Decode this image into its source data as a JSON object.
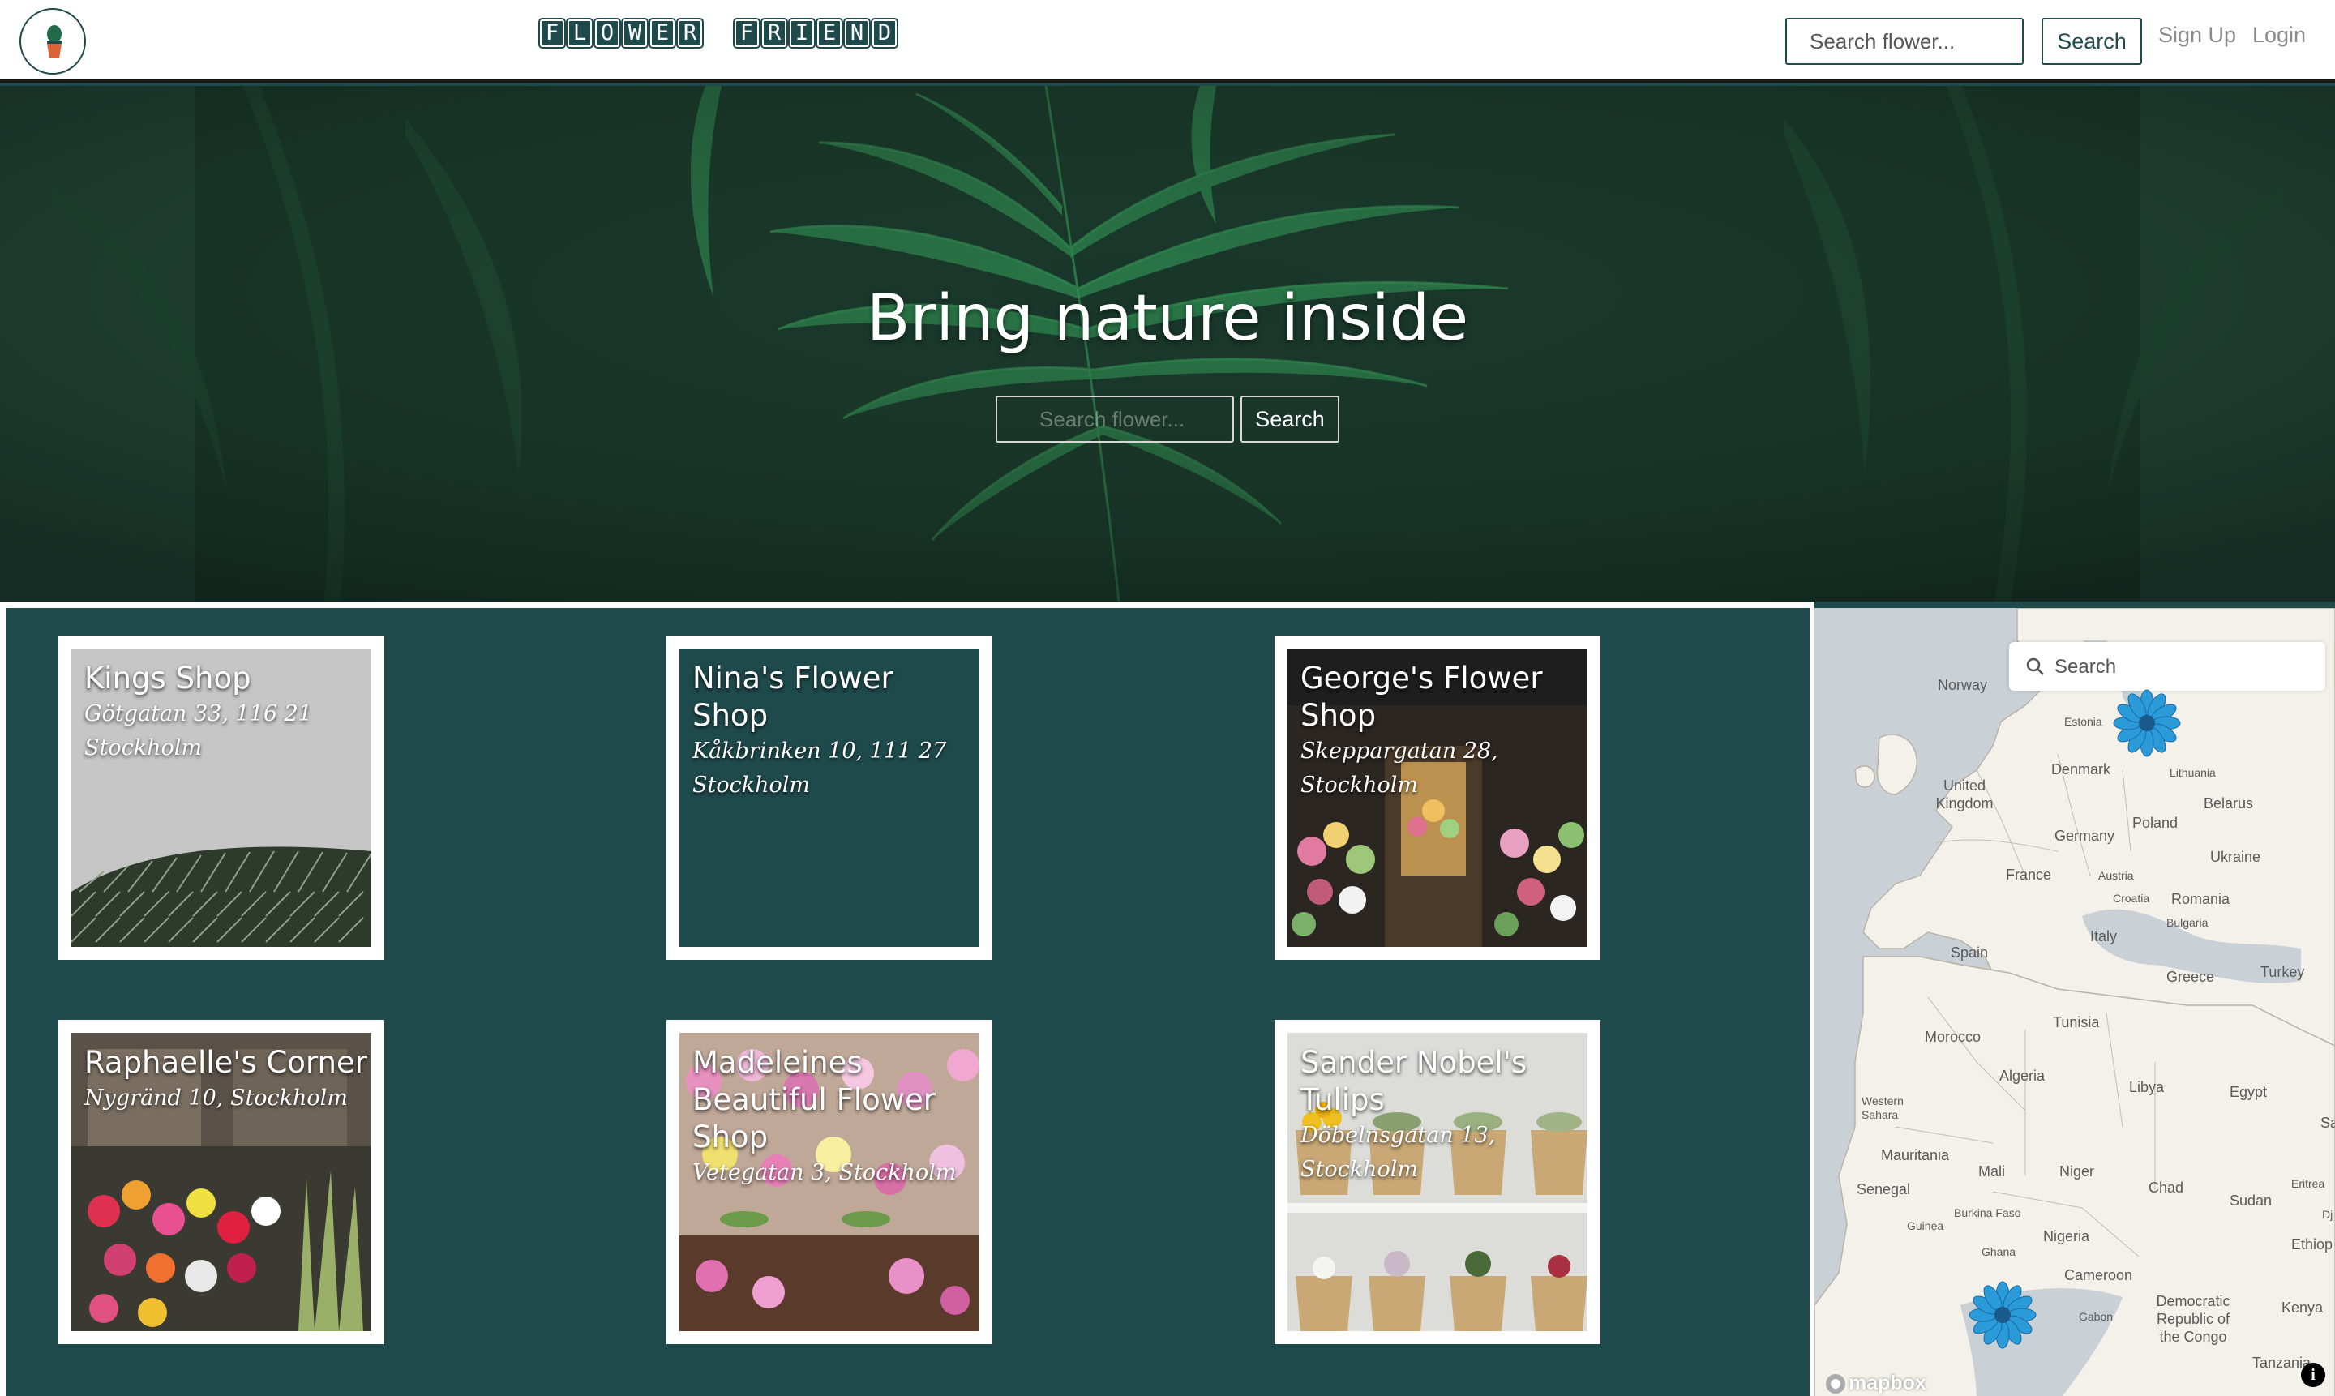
{
  "navbar": {
    "brand_words": [
      "FLOWER",
      "FRIEND"
    ],
    "search_placeholder": "Search flower...",
    "search_label": "Search",
    "signup_label": "Sign Up",
    "login_label": "Login"
  },
  "hero": {
    "title": "Bring nature inside",
    "search_placeholder": "Search flower...",
    "search_label": "Search"
  },
  "shops": [
    {
      "name": "Kings Shop",
      "address": "Götgatan 33, 116 21 Stockholm",
      "image": "architecture-dome-photo"
    },
    {
      "name": "Nina's Flower Shop",
      "address": "Kåkbrinken 10, 111 27 Stockholm",
      "image": "none"
    },
    {
      "name": "George's Flower Shop",
      "address": "Skeppargatan 28, Stockholm",
      "image": "flower-storefront-photo"
    },
    {
      "name": "Raphaelle's Corner",
      "address": "Nygränd 10, Stockholm",
      "image": "flower-market-photo"
    },
    {
      "name": "Madeleines Beautiful Flower Shop",
      "address": "Vetegatan 3, Stockholm",
      "image": "orchids-photo"
    },
    {
      "name": "Sander Nobel's Tulips",
      "address": "Döbelnsgatan 13, Stockholm",
      "image": "potted-flowers-shelf-photo"
    }
  ],
  "map": {
    "search_placeholder": "Search",
    "attribution": "mapbox",
    "labels": {
      "norway": "Norway",
      "estonia": "Estonia",
      "united_kingdom": "United Kingdom",
      "denmark": "Denmark",
      "lithuania": "Lithuania",
      "belarus": "Belarus",
      "poland": "Poland",
      "germany": "Germany",
      "ukraine": "Ukraine",
      "france": "France",
      "austria": "Austria",
      "croatia": "Croatia",
      "romania": "Romania",
      "bulgaria": "Bulgaria",
      "italy": "Italy",
      "spain": "Spain",
      "greece": "Greece",
      "turkey": "Turkey",
      "tunisia": "Tunisia",
      "morocco": "Morocco",
      "algeria": "Algeria",
      "libya": "Libya",
      "egypt": "Egypt",
      "western_sahara": "Western Sahara",
      "mauritania": "Mauritania",
      "mali": "Mali",
      "niger": "Niger",
      "chad": "Chad",
      "sudan": "Sudan",
      "senegal": "Senegal",
      "burkina_faso": "Burkina Faso",
      "guinea": "Guinea",
      "nigeria": "Nigeria",
      "ghana": "Ghana",
      "cameroon": "Cameroon",
      "gabon": "Gabon",
      "drc": "Democratic Republic of the Congo",
      "kenya": "Kenya",
      "tanzania": "Tanzania",
      "eritrea": "Eritrea",
      "ethiopia": "Ethiop",
      "djibouti": "Dj",
      "sa": "Sa"
    },
    "markers": [
      "flower-marker-stockholm",
      "flower-marker-atlantic"
    ],
    "colors": {
      "water": "#c9d1d6",
      "land": "#f4f1ea",
      "border": "#b8b2a8",
      "marker": "#2a9ad8"
    }
  },
  "colors": {
    "brand": "#1f4a4c",
    "hero_overlay": "#173428"
  }
}
